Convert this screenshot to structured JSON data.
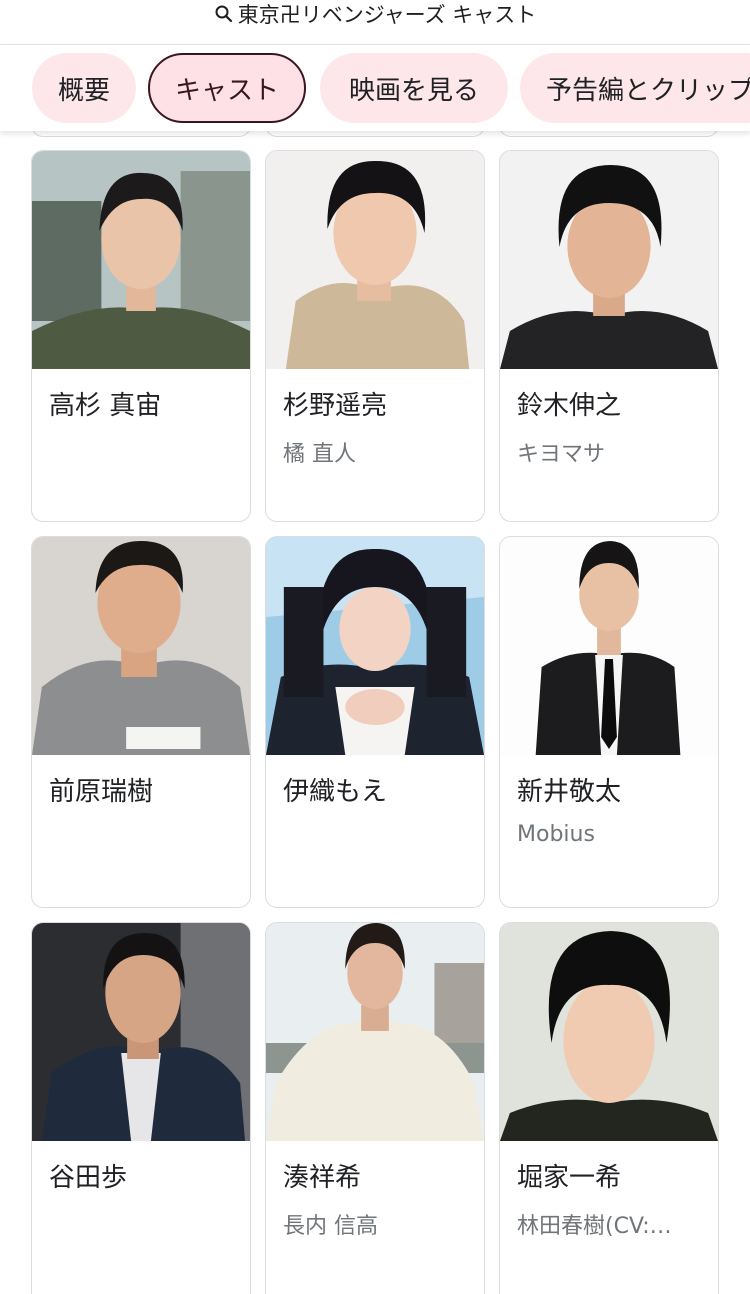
{
  "search": {
    "query": "東京卍リベンジャーズ キャスト"
  },
  "tabs": [
    "概要",
    "キャスト",
    "映画を見る",
    "予告編とクリップ"
  ],
  "active_tab": "キャスト",
  "cast": [
    {
      "name": "高杉 真宙",
      "role": ""
    },
    {
      "name": "杉野遥亮",
      "role": "橘 直人"
    },
    {
      "name": "鈴木伸之",
      "role": "キヨマサ"
    },
    {
      "name": "前原瑞樹",
      "role": ""
    },
    {
      "name": "伊織もえ",
      "role": ""
    },
    {
      "name": "新井敬太",
      "role": "Mobius"
    },
    {
      "name": "谷田歩",
      "role": ""
    },
    {
      "name": "湊祥希",
      "role": "長内 信高"
    },
    {
      "name": "堀家一希",
      "role": "林田春樹(CV:…"
    }
  ]
}
